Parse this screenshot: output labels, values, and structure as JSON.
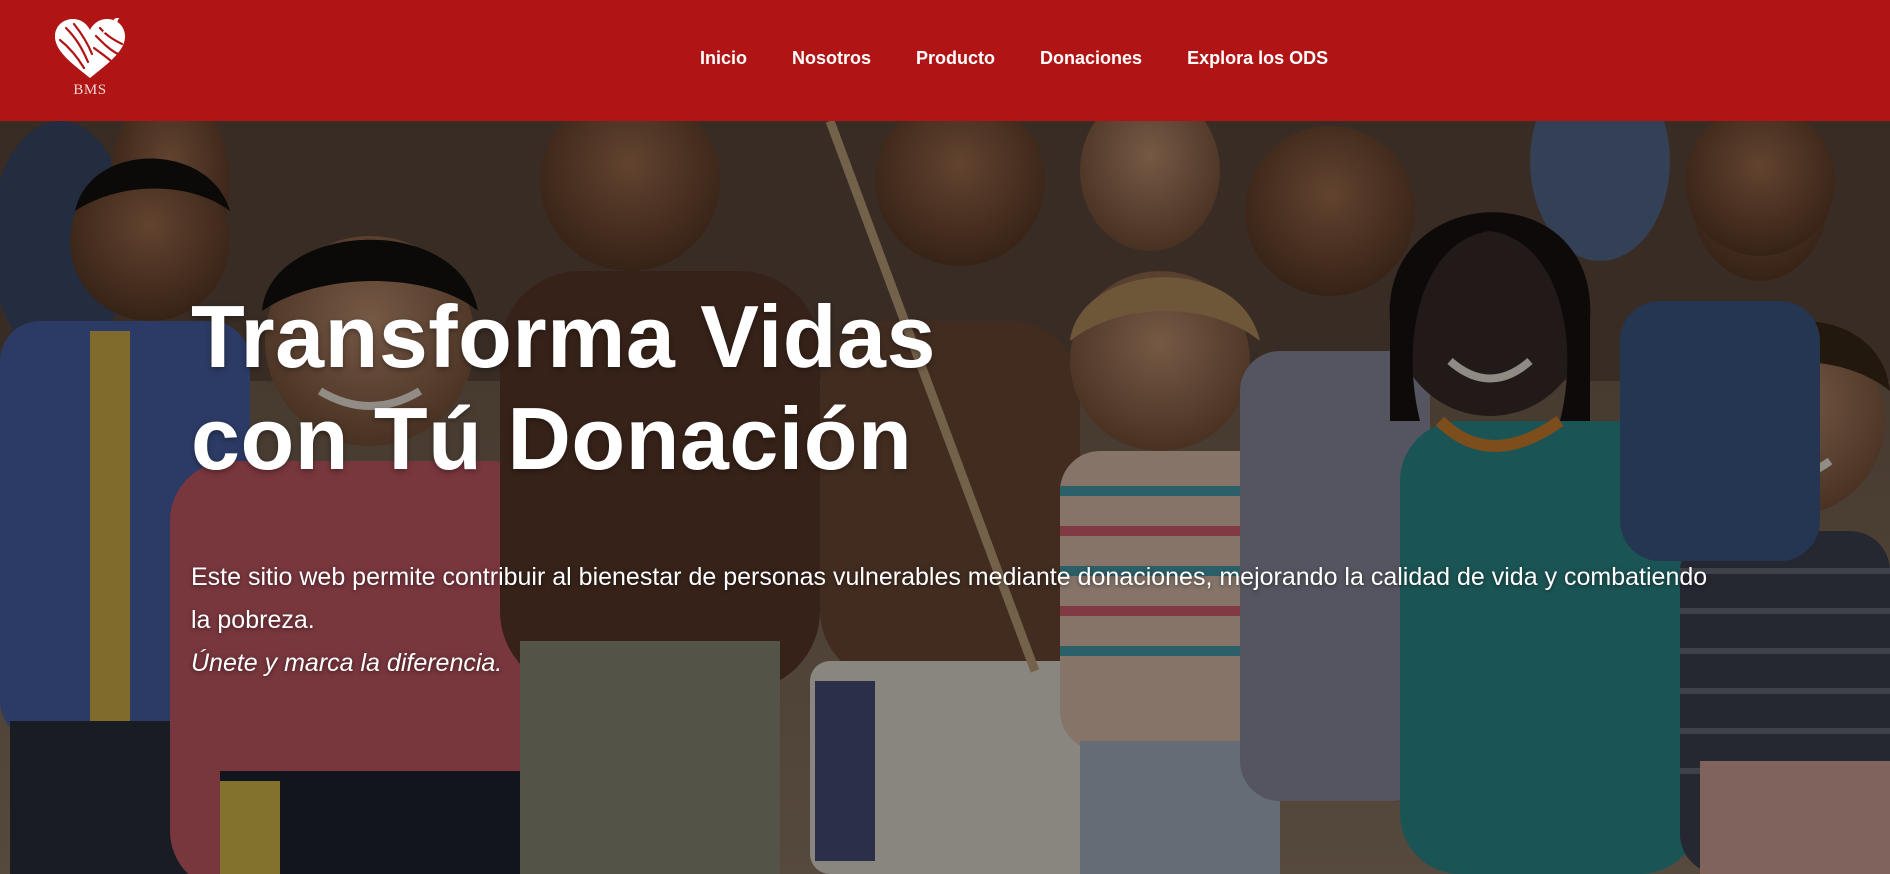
{
  "header": {
    "logo_text": "BMS",
    "nav": [
      {
        "label": "Inicio"
      },
      {
        "label": "Nosotros"
      },
      {
        "label": "Producto"
      },
      {
        "label": "Donaciones"
      },
      {
        "label": "Explora los ODS"
      }
    ]
  },
  "hero": {
    "title_line1": "Transforma Vidas",
    "title_line2": "con Tú Donación",
    "description": "Este sitio web permite contribuir al bienestar de personas vulnerables mediante donaciones, mejorando la calidad de vida y combatiendo la pobreza.",
    "cta_text": "Únete y marca la diferencia."
  },
  "colors": {
    "header_bg": "#b01414",
    "text": "#ffffff"
  },
  "icons": {
    "logo": "heart-yarn-logo-icon"
  }
}
